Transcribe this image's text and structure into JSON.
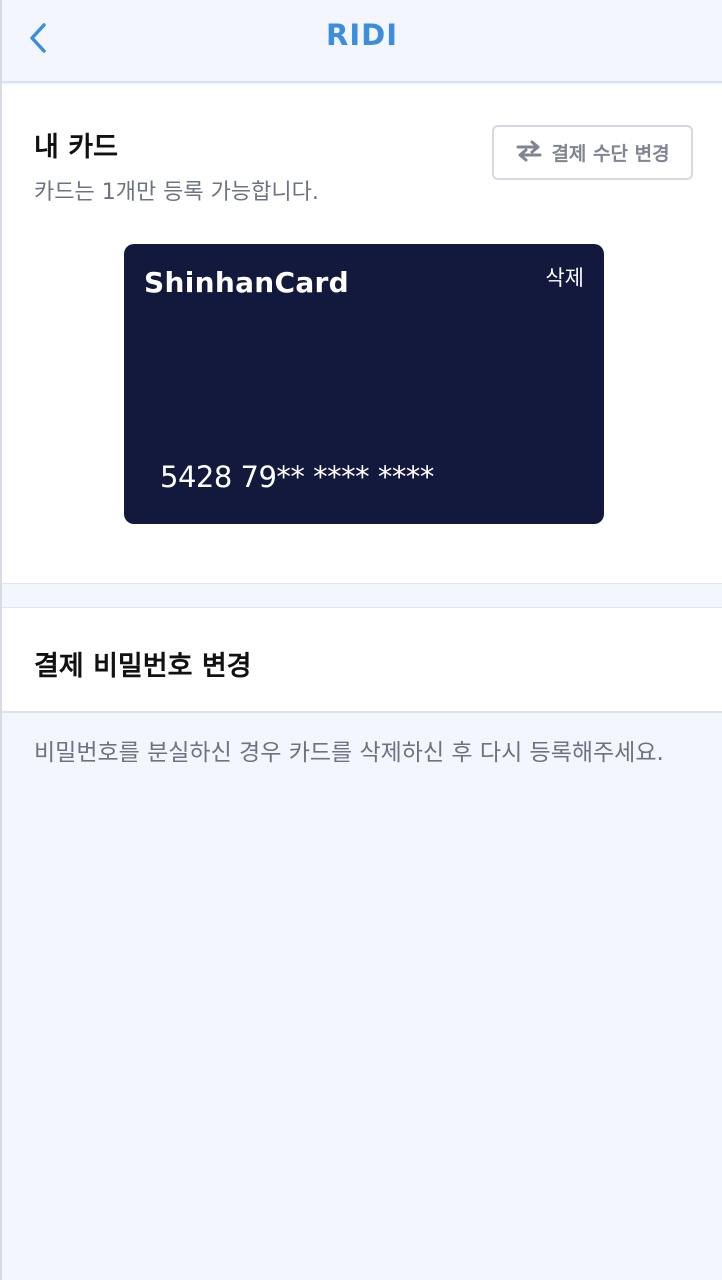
{
  "header": {
    "title": "RIDI",
    "back_icon": "chevron-left-icon",
    "accent_color": "#3c8ce0"
  },
  "my_card": {
    "title": "내 카드",
    "subtitle": "카드는 1개만 등록 가능합니다.",
    "change_method_label": "결제 수단 변경",
    "change_method_icon": "swap-arrows-icon",
    "card": {
      "brand": "ShinhanCard",
      "delete_label": "삭제",
      "number": "5428 79** **** ****",
      "card_color": "#13193c"
    }
  },
  "password_section": {
    "title": "결제 비밀번호 변경"
  },
  "notice": {
    "text": "비밀번호를 분실하신 경우 카드를 삭제하신 후 다시 등록해주세요."
  }
}
